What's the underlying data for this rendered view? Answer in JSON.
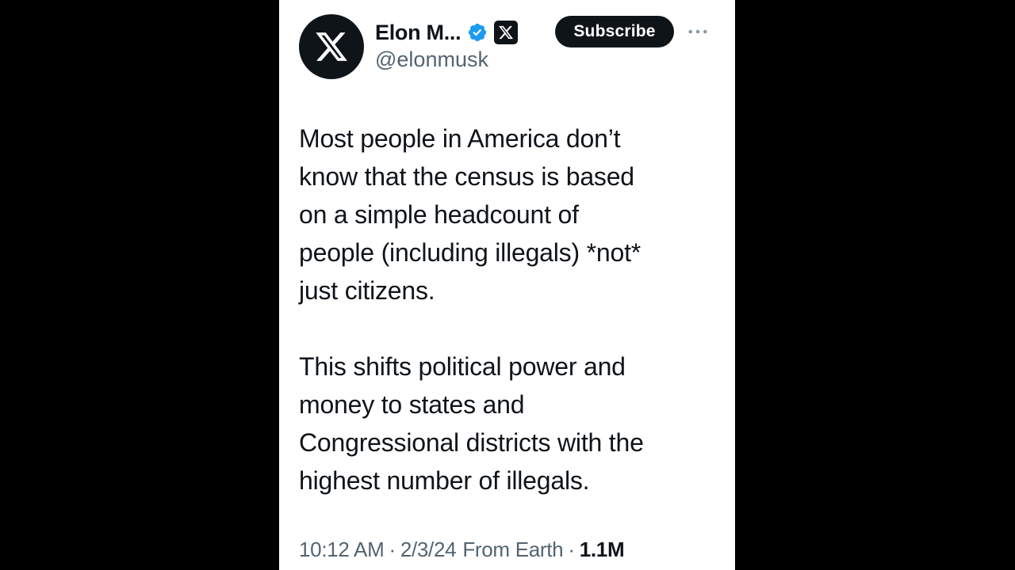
{
  "tweet": {
    "display_name": "Elon M...",
    "handle": "@elonmusk",
    "subscribe_label": "Subscribe",
    "paragraphs": [
      "Most people in America don’t\nknow that the census is based\non a simple headcount of\npeople (including illegals) *not*\njust citizens.",
      "This shifts political power and\nmoney to states and\nCongressional districts with the\nhighest number of illegals."
    ],
    "time": "10:12 AM",
    "separator": "·",
    "date": "2/3/24",
    "source": "From Earth",
    "views": "1.1M"
  },
  "icons": {
    "avatar": "x-logo-icon",
    "verified": "verified-badge-icon",
    "affiliate": "x-affiliate-icon",
    "more": "more-horizontal-icon"
  },
  "colors": {
    "background": "#000000",
    "card": "#ffffff",
    "text_primary": "#0f1419",
    "text_secondary": "#536471",
    "verified_blue": "#1d9bf0",
    "button_dark": "#0f1419"
  }
}
